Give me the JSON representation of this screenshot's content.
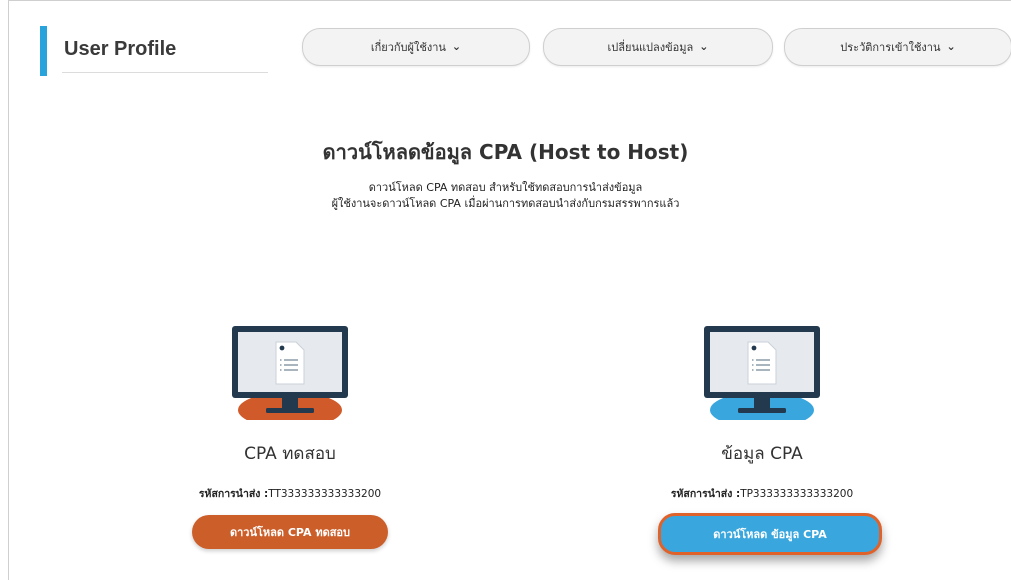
{
  "header": {
    "title": "User Profile",
    "accent_color": "#29a3dc"
  },
  "nav": {
    "tabs": [
      {
        "label": "เกี่ยวกับผู้ใช้งาน"
      },
      {
        "label": "เปลี่ยนแปลงข้อมูล"
      },
      {
        "label": "ประวัติการเข้าใช้งาน"
      }
    ],
    "chevron_icon": "chevron-down-icon"
  },
  "main": {
    "title": "ดาวน์โหลดข้อมูล CPA (Host to Host)",
    "desc_line1": "ดาวน์โหลด CPA ทดสอบ สำหรับใช้ทดสอบการนำส่งข้อมูล",
    "desc_line2": "ผู้ใช้งานจะดาวน์โหลด CPA เมื่อผ่านการทดสอบนำส่งกับกรมสรรพากรแล้ว"
  },
  "cards": [
    {
      "title": "CPA ทดสอบ",
      "code_label": "รหัสการนำส่ง :",
      "code_value": "TT333333333333200",
      "button_label": "ดาวน์โหลด CPA ทดสอบ",
      "icon": "computer-document-icon",
      "accent_color": "#d05a2a"
    },
    {
      "title": "ข้อมูล CPA",
      "code_label": "รหัสการนำส่ง :",
      "code_value": "TP333333333333200",
      "button_label": "ดาวน์โหลด ข้อมูล CPA",
      "icon": "computer-document-icon",
      "accent_color": "#3aa6de"
    }
  ]
}
